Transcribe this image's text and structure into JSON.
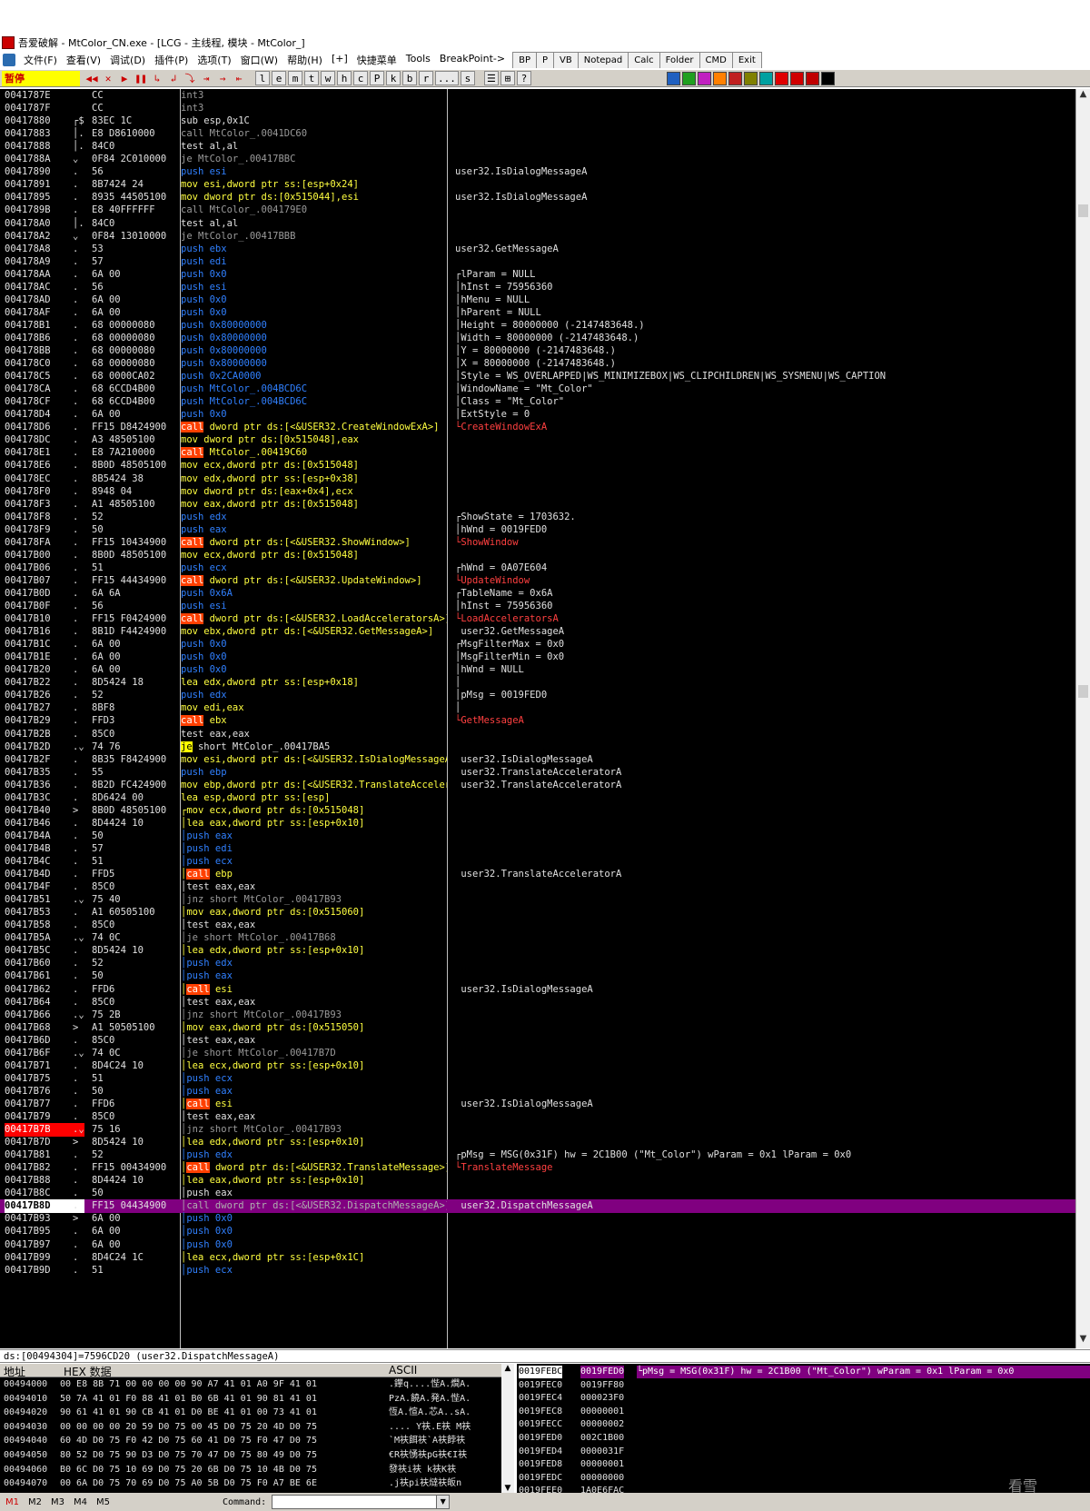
{
  "window": {
    "title": "吾爱破解 - MtColor_CN.exe - [LCG -  主线程, 模块 - MtColor_]"
  },
  "menu": [
    "文件(F)",
    "查看(V)",
    "调试(D)",
    "插件(P)",
    "选项(T)",
    "窗口(W)",
    "帮助(H)",
    "[+]",
    "快捷菜单",
    "Tools",
    "BreakPoint->"
  ],
  "tool_tabs": [
    "BP",
    "P",
    "VB",
    "Notepad",
    "Calc",
    "Folder",
    "CMD",
    "Exit"
  ],
  "toolbar": {
    "status": "暂停",
    "run_buttons": [
      "◀◀",
      "✕",
      "▶",
      "❚❚",
      "↳",
      "↲",
      "⤵",
      "⇥",
      "→",
      "⇤"
    ],
    "letter_buttons": [
      "l",
      "e",
      "m",
      "t",
      "w",
      "h",
      "c",
      "P",
      "k",
      "b",
      "r",
      "...",
      "s"
    ],
    "extra_buttons": [
      "☰",
      "⊞",
      "?"
    ],
    "plugin_colors": [
      "#2060c0",
      "#20a020",
      "#c020c0",
      "#ff8000",
      "#c02020",
      "#808000",
      "#00a0a0",
      "#e00000",
      "#d00000",
      "#c00000",
      "#000000"
    ]
  },
  "disasm": [
    {
      "a": "0041787E",
      "j": "",
      "b": "CC",
      "d": "int3",
      "s": "gray",
      "c": ""
    },
    {
      "a": "0041787F",
      "j": "",
      "b": "CC",
      "d": "int3",
      "s": "gray",
      "c": ""
    },
    {
      "a": "00417880",
      "j": "┌$",
      "b": "83EC 1C",
      "d": "sub esp,0x1C",
      "s": "default",
      "c": ""
    },
    {
      "a": "00417883",
      "j": "│.",
      "b": "E8 D8610000",
      "d": "call MtColor_.0041DC60",
      "s": "gray",
      "c": ""
    },
    {
      "a": "00417888",
      "j": "│.",
      "b": "84C0",
      "d": "test al,al",
      "s": "default",
      "c": ""
    },
    {
      "a": "0041788A",
      "j": "⌄",
      "b": "0F84 2C010000",
      "d": "je MtColor_.00417BBC",
      "s": "gray",
      "c": ""
    },
    {
      "a": "00417890",
      "j": ".",
      "b": "56",
      "d": "push esi",
      "s": "blue",
      "c": "user32.IsDialogMessageA"
    },
    {
      "a": "00417891",
      "j": ".",
      "b": "8B7424 24",
      "d": "mov esi,dword ptr ss:[esp+0x24]",
      "s": "yellow",
      "c": ""
    },
    {
      "a": "00417895",
      "j": ".",
      "b": "8935 44505100",
      "d": "mov dword ptr ds:[0x515044],esi",
      "s": "yellow",
      "c": "user32.IsDialogMessageA"
    },
    {
      "a": "0041789B",
      "j": ".",
      "b": "E8 40FFFFFF",
      "d": "call MtColor_.004179E0",
      "s": "gray",
      "c": ""
    },
    {
      "a": "004178A0",
      "j": "│.",
      "b": "84C0",
      "d": "test al,al",
      "s": "default",
      "c": ""
    },
    {
      "a": "004178A2",
      "j": "⌄",
      "b": "0F84 13010000",
      "d": "je MtColor_.00417BBB",
      "s": "gray",
      "c": ""
    },
    {
      "a": "004178A8",
      "j": ".",
      "b": "53",
      "d": "push ebx",
      "s": "blue",
      "c": "user32.GetMessageA"
    },
    {
      "a": "004178A9",
      "j": ".",
      "b": "57",
      "d": "push edi",
      "s": "blue",
      "c": ""
    },
    {
      "a": "004178AA",
      "j": ".",
      "b": "6A 00",
      "d": "push 0x0",
      "s": "blue",
      "c": "┌lParam = NULL"
    },
    {
      "a": "004178AC",
      "j": ".",
      "b": "56",
      "d": "push esi",
      "s": "blue",
      "c": "│hInst = 75956360"
    },
    {
      "a": "004178AD",
      "j": ".",
      "b": "6A 00",
      "d": "push 0x0",
      "s": "blue",
      "c": "│hMenu = NULL"
    },
    {
      "a": "004178AF",
      "j": ".",
      "b": "6A 00",
      "d": "push 0x0",
      "s": "blue",
      "c": "│hParent = NULL"
    },
    {
      "a": "004178B1",
      "j": ".",
      "b": "68 00000080",
      "d": "push 0x80000000",
      "s": "blue",
      "c": "│Height = 80000000 (-2147483648.)"
    },
    {
      "a": "004178B6",
      "j": ".",
      "b": "68 00000080",
      "d": "push 0x80000000",
      "s": "blue",
      "c": "│Width = 80000000 (-2147483648.)"
    },
    {
      "a": "004178BB",
      "j": ".",
      "b": "68 00000080",
      "d": "push 0x80000000",
      "s": "blue",
      "c": "│Y = 80000000 (-2147483648.)"
    },
    {
      "a": "004178C0",
      "j": ".",
      "b": "68 00000080",
      "d": "push 0x80000000",
      "s": "blue",
      "c": "│X = 80000000 (-2147483648.)"
    },
    {
      "a": "004178C5",
      "j": ".",
      "b": "68 0000CA02",
      "d": "push 0x2CA0000",
      "s": "blue",
      "c": "│Style = WS_OVERLAPPED|WS_MINIMIZEBOX|WS_CLIPCHILDREN|WS_SYSMENU|WS_CAPTION"
    },
    {
      "a": "004178CA",
      "j": ".",
      "b": "68 6CCD4B00",
      "d": "push MtColor_.004BCD6C",
      "s": "blue",
      "c": "│WindowName = \"Mt_Color\""
    },
    {
      "a": "004178CF",
      "j": ".",
      "b": "68 6CCD4B00",
      "d": "push MtColor_.004BCD6C",
      "s": "blue",
      "c": "│Class = \"Mt_Color\""
    },
    {
      "a": "004178D4",
      "j": ".",
      "b": "6A 00",
      "d": "push 0x0",
      "s": "blue",
      "c": "│ExtStyle = 0"
    },
    {
      "a": "004178D6",
      "j": ".",
      "b": "FF15 D8424900",
      "d": "call dword ptr ds:[<&USER32.CreateWindowExA>]",
      "s": "call",
      "c": "└CreateWindowExA"
    },
    {
      "a": "004178DC",
      "j": ".",
      "b": "A3 48505100",
      "d": "mov dword ptr ds:[0x515048],eax",
      "s": "yellow",
      "c": ""
    },
    {
      "a": "004178E1",
      "j": ".",
      "b": "E8 7A210000",
      "d": "call MtColor_.00419C60",
      "s": "call",
      "c": ""
    },
    {
      "a": "004178E6",
      "j": ".",
      "b": "8B0D 48505100",
      "d": "mov ecx,dword ptr ds:[0x515048]",
      "s": "yellow",
      "c": ""
    },
    {
      "a": "004178EC",
      "j": ".",
      "b": "8B5424 38",
      "d": "mov edx,dword ptr ss:[esp+0x38]",
      "s": "yellow",
      "c": ""
    },
    {
      "a": "004178F0",
      "j": ".",
      "b": "8948 04",
      "d": "mov dword ptr ds:[eax+0x4],ecx",
      "s": "yellow",
      "c": ""
    },
    {
      "a": "004178F3",
      "j": ".",
      "b": "A1 48505100",
      "d": "mov eax,dword ptr ds:[0x515048]",
      "s": "yellow",
      "c": ""
    },
    {
      "a": "004178F8",
      "j": ".",
      "b": "52",
      "d": "push edx",
      "s": "blue",
      "c": "┌ShowState = 1703632."
    },
    {
      "a": "004178F9",
      "j": ".",
      "b": "50",
      "d": "push eax",
      "s": "blue",
      "c": "│hWnd = 0019FED0"
    },
    {
      "a": "004178FA",
      "j": ".",
      "b": "FF15 10434900",
      "d": "call dword ptr ds:[<&USER32.ShowWindow>]",
      "s": "call",
      "c": "└ShowWindow"
    },
    {
      "a": "00417B00",
      "j": ".",
      "b": "8B0D 48505100",
      "d": "mov ecx,dword ptr ds:[0x515048]",
      "s": "yellow",
      "c": ""
    },
    {
      "a": "00417B06",
      "j": ".",
      "b": "51",
      "d": "push ecx",
      "s": "blue",
      "c": "┌hWnd = 0A07E604"
    },
    {
      "a": "00417B07",
      "j": ".",
      "b": "FF15 44434900",
      "d": "call dword ptr ds:[<&USER32.UpdateWindow>]",
      "s": "call",
      "c": "└UpdateWindow"
    },
    {
      "a": "00417B0D",
      "j": ".",
      "b": "6A 6A",
      "d": "push 0x6A",
      "s": "blue",
      "c": "┌TableName = 0x6A"
    },
    {
      "a": "00417B0F",
      "j": ".",
      "b": "56",
      "d": "push esi",
      "s": "blue",
      "c": "│hInst = 75956360"
    },
    {
      "a": "00417B10",
      "j": ".",
      "b": "FF15 F0424900",
      "d": "call dword ptr ds:[<&USER32.LoadAcceleratorsA>]",
      "s": "call",
      "c": "└LoadAcceleratorsA"
    },
    {
      "a": "00417B16",
      "j": ".",
      "b": "8B1D F4424900",
      "d": "mov ebx,dword ptr ds:[<&USER32.GetMessageA>]",
      "s": "yellow",
      "c": " user32.GetMessageA"
    },
    {
      "a": "00417B1C",
      "j": ".",
      "b": "6A 00",
      "d": "push 0x0",
      "s": "blue",
      "c": "┌MsgFilterMax = 0x0"
    },
    {
      "a": "00417B1E",
      "j": ".",
      "b": "6A 00",
      "d": "push 0x0",
      "s": "blue",
      "c": "│MsgFilterMin = 0x0"
    },
    {
      "a": "00417B20",
      "j": ".",
      "b": "6A 00",
      "d": "push 0x0",
      "s": "blue",
      "c": "│hWnd = NULL"
    },
    {
      "a": "00417B22",
      "j": ".",
      "b": "8D5424 18",
      "d": "lea edx,dword ptr ss:[esp+0x18]",
      "s": "yellow",
      "c": "│"
    },
    {
      "a": "00417B26",
      "j": ".",
      "b": "52",
      "d": "push edx",
      "s": "blue",
      "c": "│pMsg = 0019FED0"
    },
    {
      "a": "00417B27",
      "j": ".",
      "b": "8BF8",
      "d": "mov edi,eax",
      "s": "yellow",
      "c": "│"
    },
    {
      "a": "00417B29",
      "j": ".",
      "b": "FFD3",
      "d": "call ebx",
      "s": "call",
      "c": "└GetMessageA"
    },
    {
      "a": "00417B2B",
      "j": ".",
      "b": "85C0",
      "d": "test eax,eax",
      "s": "default",
      "c": ""
    },
    {
      "a": "00417B2D",
      "j": ".⌄",
      "b": "74 76",
      "d": "je short MtColor_.00417BA5",
      "s": "jcc",
      "c": ""
    },
    {
      "a": "00417B2F",
      "j": ".",
      "b": "8B35 F8424900",
      "d": "mov esi,dword ptr ds:[<&USER32.IsDialogMessageA>]",
      "s": "yellow",
      "c": " user32.IsDialogMessageA"
    },
    {
      "a": "00417B35",
      "j": ".",
      "b": "55",
      "d": "push ebp",
      "s": "blue",
      "c": " user32.TranslateAcceleratorA"
    },
    {
      "a": "00417B36",
      "j": ".",
      "b": "8B2D FC424900",
      "d": "mov ebp,dword ptr ds:[<&USER32.TranslateAcceleratorA>]",
      "s": "yellow",
      "c": " user32.TranslateAcceleratorA"
    },
    {
      "a": "00417B3C",
      "j": ".",
      "b": "8D6424 00",
      "d": "lea esp,dword ptr ss:[esp]",
      "s": "yellow",
      "c": ""
    },
    {
      "a": "00417B40",
      "j": ">",
      "b": "8B0D 48505100",
      "d": "┌mov ecx,dword ptr ds:[0x515048]",
      "s": "yellow",
      "c": ""
    },
    {
      "a": "00417B46",
      "j": ".",
      "b": "8D4424 10",
      "d": "│lea eax,dword ptr ss:[esp+0x10]",
      "s": "yellow",
      "c": ""
    },
    {
      "a": "00417B4A",
      "j": ".",
      "b": "50",
      "d": "│push eax",
      "s": "blue",
      "c": ""
    },
    {
      "a": "00417B4B",
      "j": ".",
      "b": "57",
      "d": "│push edi",
      "s": "blue",
      "c": ""
    },
    {
      "a": "00417B4C",
      "j": ".",
      "b": "51",
      "d": "│push ecx",
      "s": "blue",
      "c": ""
    },
    {
      "a": "00417B4D",
      "j": ".",
      "b": "FFD5",
      "d": "│call ebp",
      "s": "call",
      "c": " user32.TranslateAcceleratorA"
    },
    {
      "a": "00417B4F",
      "j": ".",
      "b": "85C0",
      "d": "│test eax,eax",
      "s": "default",
      "c": ""
    },
    {
      "a": "00417B51",
      "j": ".⌄",
      "b": "75 40",
      "d": "│jnz short MtColor_.00417B93",
      "s": "gray",
      "c": ""
    },
    {
      "a": "00417B53",
      "j": ".",
      "b": "A1 60505100",
      "d": "│mov eax,dword ptr ds:[0x515060]",
      "s": "yellow",
      "c": ""
    },
    {
      "a": "00417B58",
      "j": ".",
      "b": "85C0",
      "d": "│test eax,eax",
      "s": "default",
      "c": ""
    },
    {
      "a": "00417B5A",
      "j": ".⌄",
      "b": "74 0C",
      "d": "│je short MtColor_.00417B68",
      "s": "gray",
      "c": ""
    },
    {
      "a": "00417B5C",
      "j": ".",
      "b": "8D5424 10",
      "d": "│lea edx,dword ptr ss:[esp+0x10]",
      "s": "yellow",
      "c": ""
    },
    {
      "a": "00417B60",
      "j": ".",
      "b": "52",
      "d": "│push edx",
      "s": "blue",
      "c": ""
    },
    {
      "a": "00417B61",
      "j": ".",
      "b": "50",
      "d": "│push eax",
      "s": "blue",
      "c": ""
    },
    {
      "a": "00417B62",
      "j": ".",
      "b": "FFD6",
      "d": "│call esi",
      "s": "call",
      "c": " user32.IsDialogMessageA"
    },
    {
      "a": "00417B64",
      "j": ".",
      "b": "85C0",
      "d": "│test eax,eax",
      "s": "default",
      "c": ""
    },
    {
      "a": "00417B66",
      "j": ".⌄",
      "b": "75 2B",
      "d": "│jnz short MtColor_.00417B93",
      "s": "gray",
      "c": ""
    },
    {
      "a": "00417B68",
      "j": ">",
      "b": "A1 50505100",
      "d": "│mov eax,dword ptr ds:[0x515050]",
      "s": "yellow",
      "c": ""
    },
    {
      "a": "00417B6D",
      "j": ".",
      "b": "85C0",
      "d": "│test eax,eax",
      "s": "default",
      "c": ""
    },
    {
      "a": "00417B6F",
      "j": ".⌄",
      "b": "74 0C",
      "d": "│je short MtColor_.00417B7D",
      "s": "gray",
      "c": ""
    },
    {
      "a": "00417B71",
      "j": ".",
      "b": "8D4C24 10",
      "d": "│lea ecx,dword ptr ss:[esp+0x10]",
      "s": "yellow",
      "c": ""
    },
    {
      "a": "00417B75",
      "j": ".",
      "b": "51",
      "d": "│push ecx",
      "s": "blue",
      "c": ""
    },
    {
      "a": "00417B76",
      "j": ".",
      "b": "50",
      "d": "│push eax",
      "s": "blue",
      "c": ""
    },
    {
      "a": "00417B77",
      "j": ".",
      "b": "FFD6",
      "d": "│call esi",
      "s": "call",
      "c": " user32.IsDialogMessageA"
    },
    {
      "a": "00417B79",
      "j": ".",
      "b": "85C0",
      "d": "│test eax,eax",
      "s": "default",
      "c": ""
    },
    {
      "a": "00417B7B",
      "j": ".⌄",
      "b": "75 16",
      "d": "│jnz short MtColor_.00417B93",
      "s": "gray",
      "c": "",
      "bp": true
    },
    {
      "a": "00417B7D",
      "j": ">",
      "b": "8D5424 10",
      "d": "│lea edx,dword ptr ss:[esp+0x10]",
      "s": "yellow",
      "c": ""
    },
    {
      "a": "00417B81",
      "j": ".",
      "b": "52",
      "d": "│push edx",
      "s": "blue",
      "c": "┌pMsg = MSG(0x31F) hw = 2C1B00 (\"Mt_Color\") wParam = 0x1 lParam = 0x0"
    },
    {
      "a": "00417B82",
      "j": ".",
      "b": "FF15 00434900",
      "d": "│call dword ptr ds:[<&USER32.TranslateMessage>]",
      "s": "call",
      "c": "└TranslateMessage"
    },
    {
      "a": "00417B88",
      "j": ".",
      "b": "8D4424 10",
      "d": "│lea eax,dword ptr ss:[esp+0x10]",
      "s": "yellow",
      "c": ""
    },
    {
      "a": "00417B8C",
      "j": ".",
      "b": "50",
      "d": "│push eax",
      "s": "default",
      "c": ""
    },
    {
      "a": "00417B8D",
      "j": ".",
      "b": "FF15 04434900",
      "d": "│call dword ptr ds:[<&USER32.DispatchMessageA>]",
      "s": "gray",
      "c": " user32.DispatchMessageA",
      "hl": true
    },
    {
      "a": "00417B93",
      "j": ">",
      "b": "6A 00",
      "d": "│push 0x0",
      "s": "blue",
      "c": ""
    },
    {
      "a": "00417B95",
      "j": ".",
      "b": "6A 00",
      "d": "│push 0x0",
      "s": "blue",
      "c": ""
    },
    {
      "a": "00417B97",
      "j": ".",
      "b": "6A 00",
      "d": "│push 0x0",
      "s": "blue",
      "c": ""
    },
    {
      "a": "00417B99",
      "j": ".",
      "b": "8D4C24 1C",
      "d": "│lea ecx,dword ptr ss:[esp+0x1C]",
      "s": "yellow",
      "c": ""
    },
    {
      "a": "00417B9D",
      "j": ".",
      "b": "51",
      "d": "│push ecx",
      "s": "blue",
      "c": ""
    }
  ],
  "info_line": "ds:[00494304]=7596CD20 (user32.DispatchMessageA)",
  "dump": {
    "headers": {
      "address": "地址",
      "hex": "HEX 数据",
      "ascii": "ASCII"
    },
    "rows": [
      {
        "addr": "00494000",
        "hex": "00 E8 8B 71 00 00 00 00 90 A7 41 01 A0 9F 41 01",
        "ascii": ".鑻q....悂A.燗A."
      },
      {
        "addr": "00494010",
        "hex": "50 7A 41 01 F0 88 41 01 B0 6B 41 01 90 81 41 01",
        "ascii": "PzA.饒A.発A.悂A."
      },
      {
        "addr": "00494020",
        "hex": "90 61 41 01 90 CB 41 01 D0 BE 41 01 00 73 41 01",
        "ascii": "恆A.愃A.芯A..sA."
      },
      {
        "addr": "00494030",
        "hex": "00 00 00 00 20 59 D0 75 00 45 D0 75 20 4D D0 75",
        "ascii": ".... Y衭.E衭 M衭"
      },
      {
        "addr": "00494040",
        "hex": "60 4D D0 75 F0 42 D0 75 60 41 D0 75 F0 47 D0 75",
        "ascii": "`M衭餌衭`A衭餑衭"
      },
      {
        "addr": "00494050",
        "hex": "80 52 D0 75 90 D3 D0 75 70 47 D0 75 80 49 D0 75",
        "ascii": "€R衭愑衭pG衭€I衭"
      },
      {
        "addr": "00494060",
        "hex": "B0 6C D0 75 10 69 D0 75 20 6B D0 75 10 4B D0 75",
        "ascii": "發衭i衭 k衭K衭"
      },
      {
        "addr": "00494070",
        "hex": "00 6A D0 75 70 69 D0 75 A0 5B D0 75 F0 A7 BE 6E",
        "ascii": ".j衭pi衭燵衭皈n"
      }
    ]
  },
  "stack": [
    {
      "addr": "0019FEBC",
      "val": "0019FED0",
      "com": "└pMsg = MSG(0x31F) hw = 2C1B00 (\"Mt_Color\") wParam = 0x1 lParam = 0x0",
      "hl": true
    },
    {
      "addr": "0019FEC0",
      "val": "0019FF80",
      "com": ""
    },
    {
      "addr": "0019FEC4",
      "val": "000023F0",
      "com": ""
    },
    {
      "addr": "0019FEC8",
      "val": "00000001",
      "com": ""
    },
    {
      "addr": "0019FECC",
      "val": "00000002",
      "com": ""
    },
    {
      "addr": "0019FED0",
      "val": "002C1B00",
      "com": ""
    },
    {
      "addr": "0019FED4",
      "val": "0000031F",
      "com": ""
    },
    {
      "addr": "0019FED8",
      "val": "00000001",
      "com": ""
    },
    {
      "addr": "0019FEDC",
      "val": "00000000",
      "com": ""
    },
    {
      "addr": "0019FEE0",
      "val": "1A0E6FAC",
      "com": ""
    }
  ],
  "bottom": {
    "tabs": [
      "M1",
      "M2",
      "M3",
      "M4",
      "M5"
    ],
    "command_label": "Command:"
  },
  "watermark": "看雪"
}
